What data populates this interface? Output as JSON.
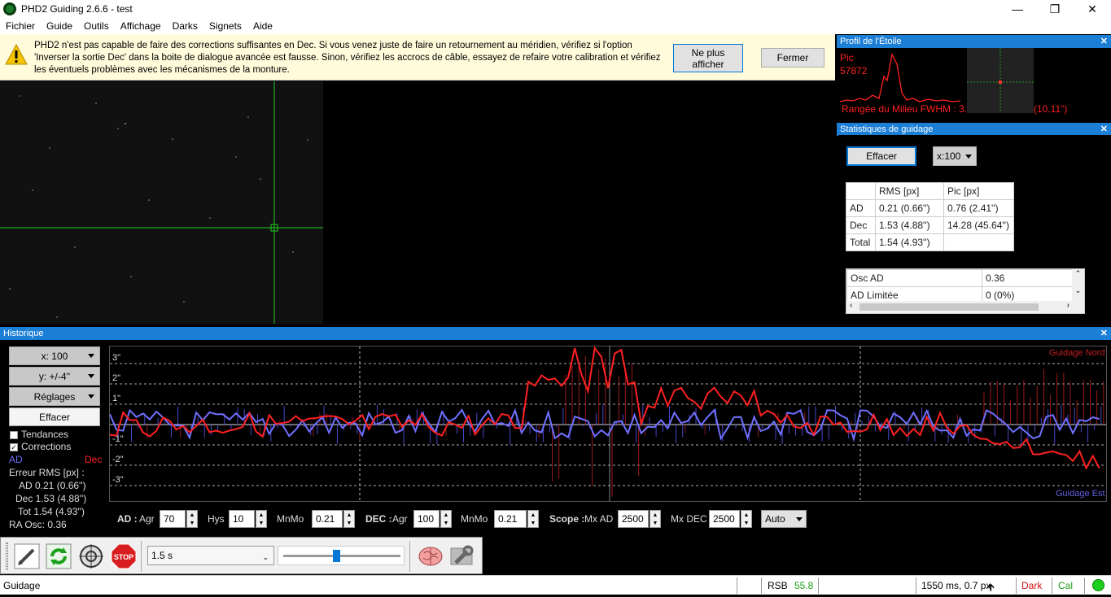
{
  "window": {
    "title": "PHD2 Guiding 2.6.6 - test"
  },
  "menu": [
    "Fichier",
    "Guide",
    "Outils",
    "Affichage",
    "Darks",
    "Signets",
    "Aide"
  ],
  "infobar": {
    "line1": "PHD2 n'est pas capable de faire des corrections suffisantes en Dec. Si vous venez juste de faire un retournement au méridien, vérifiez si l'option",
    "line2": "'Inverser la sortie Dec' dans la boite de dialogue avancée est fausse. Sinon, vérifiez les accrocs de câble, essayez de refaire votre calibration et vérifiez",
    "line3": "les éventuels problèmes avec les mécanismes de la monture.",
    "btn_hide_1": "Ne plus",
    "btn_hide_2": "afficher",
    "btn_close": "Fermer"
  },
  "profile": {
    "title": "Profil de l'Étoile",
    "peak_label": "Pic",
    "peak_value": "57872",
    "fwhm_label": "Rangée du Milieu FWHM : 3.",
    "fwhm_arcsec": "(10.11\")"
  },
  "stats": {
    "title": "Statistiques de guidage",
    "clear": "Effacer",
    "scale": "x:100",
    "headers": [
      "",
      "RMS [px]",
      "Pic [px]"
    ],
    "rows": [
      [
        "AD",
        "0.21 (0.66'')",
        "0.76 (2.41'')"
      ],
      [
        "Dec",
        "1.53 (4.88'')",
        "14.28 (45.64'')"
      ],
      [
        "Total",
        "1.54 (4.93'')",
        ""
      ]
    ],
    "osc_rows": [
      [
        "Osc AD",
        "0.36"
      ],
      [
        "AD Limitée",
        "0 (0%)"
      ]
    ]
  },
  "history": {
    "title": "Historique",
    "xscale": "x: 100",
    "yscale": "y: +/-4''",
    "settings": "Réglages",
    "clear": "Effacer",
    "trends": "Tendances",
    "corrections": "Corrections",
    "ra_label": "AD",
    "dec_label": "Dec",
    "rms_title": "Erreur RMS [px] :",
    "rms_ad": "AD  0.21 (0.66'')",
    "rms_dec": "Dec  1.53 (4.88'')",
    "rms_tot": "Tot  1.54 (4.93'')",
    "ra_osc": "RA Osc: 0.36",
    "guide_north": "Guidage Nord",
    "guide_east": "Guidage Est",
    "yticks": [
      "3\"",
      "2\"",
      "1\"",
      "-1\"",
      "-2\"",
      "-3\""
    ]
  },
  "params": {
    "ad": "AD :",
    "agr": "Agr",
    "ad_agr": "70",
    "hys": "Hys",
    "ad_hys": "10",
    "mnmo": "MnMo",
    "ad_mnmo": "0.21",
    "dec": "DEC :",
    "dec_agr": "100",
    "dec_mnmo": "0.21",
    "scope": "Scope :",
    "mxad_label": "Mx AD",
    "mxad": "2500",
    "mxdec_label": "Mx DEC",
    "mxdec": "2500",
    "auto": "Auto"
  },
  "toolbar": {
    "exposure": "1.5 s"
  },
  "status": {
    "mode": "Guidage",
    "snr_label": "RSB",
    "snr": "55.8",
    "info": "1550 ms, 0.7 px",
    "dark": "Dark",
    "cal": "Cal"
  },
  "colors": {
    "ra": "#7070ff",
    "dec": "#ff2020",
    "accent": "#1c7fd6"
  }
}
